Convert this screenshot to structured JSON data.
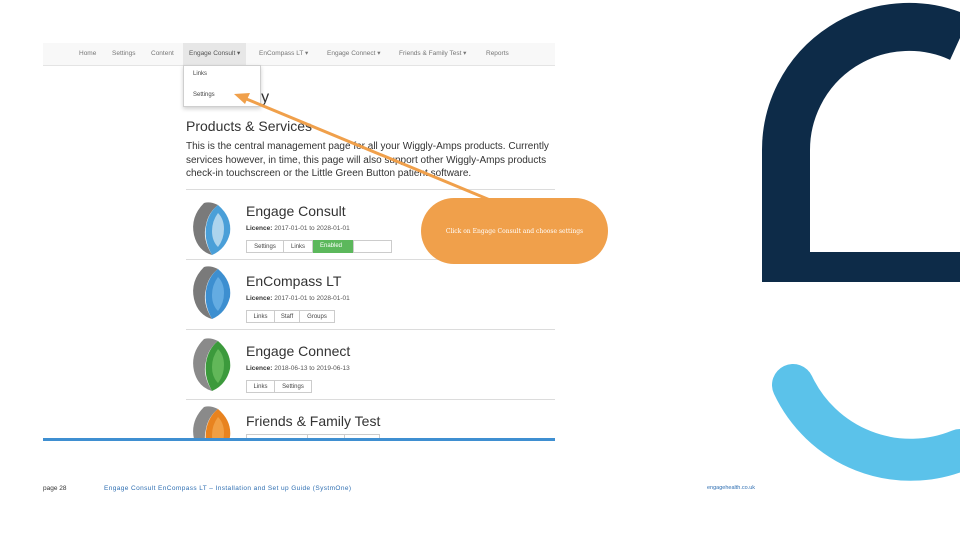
{
  "navbar": {
    "items": [
      {
        "label": "Home",
        "active": false
      },
      {
        "label": "Settings",
        "active": false
      },
      {
        "label": "Content",
        "active": false
      },
      {
        "label": "Engage Consult ▾",
        "active": true
      },
      {
        "label": "EnCompass LT ▾",
        "active": false
      },
      {
        "label": "Engage Connect ▾",
        "active": false
      },
      {
        "label": "Friends & Family Test ▾",
        "active": false
      },
      {
        "label": "Reports",
        "active": false
      }
    ]
  },
  "dropdown": {
    "items": [
      "Links",
      "Settings"
    ]
  },
  "page": {
    "title_fragment": "gery",
    "section_title": "Products & Services",
    "intro_lines": [
      "This is the central management page for all your Wiggly-Amps products. Currently",
      "services however, in time, this page will also support other Wiggly-Amps products",
      "check-in touchscreen or the Little Green Button patient software."
    ]
  },
  "products": [
    {
      "name": "Engage Consult",
      "licence_label": "Licence:",
      "licence_value": "2017-01-01 to 2028-01-01",
      "buttons": [
        "Settings",
        "Links"
      ],
      "toggle_label": "Enabled",
      "icon_color": "#4a9fd8"
    },
    {
      "name": "EnCompass LT",
      "licence_label": "Licence:",
      "licence_value": "2017-01-01 to 2028-01-01",
      "buttons": [
        "Links",
        "Staff",
        "Groups"
      ],
      "icon_color": "#3d8fd0"
    },
    {
      "name": "Engage Connect",
      "licence_label": "Licence:",
      "licence_value": "2018-06-13 to 2019-06-13",
      "buttons": [
        "Links",
        "Settings"
      ],
      "icon_color": "#3c9a3c"
    },
    {
      "name": "Friends & Family Test",
      "icon_color": "#e8831f"
    }
  ],
  "callout": {
    "text": "Click on Engage Consult and choose settings"
  },
  "footer": {
    "page": "page 28",
    "document": "Engage Consult EnCompass LT – Installation and Set up Guide (SystmOne)",
    "website": "engagehealth.co.uk"
  },
  "colors": {
    "brand_navy": "#0d2b48",
    "brand_light_blue": "#5bc2ea",
    "callout_orange": "#f0a04b",
    "enabled_green": "#5cb85c"
  }
}
